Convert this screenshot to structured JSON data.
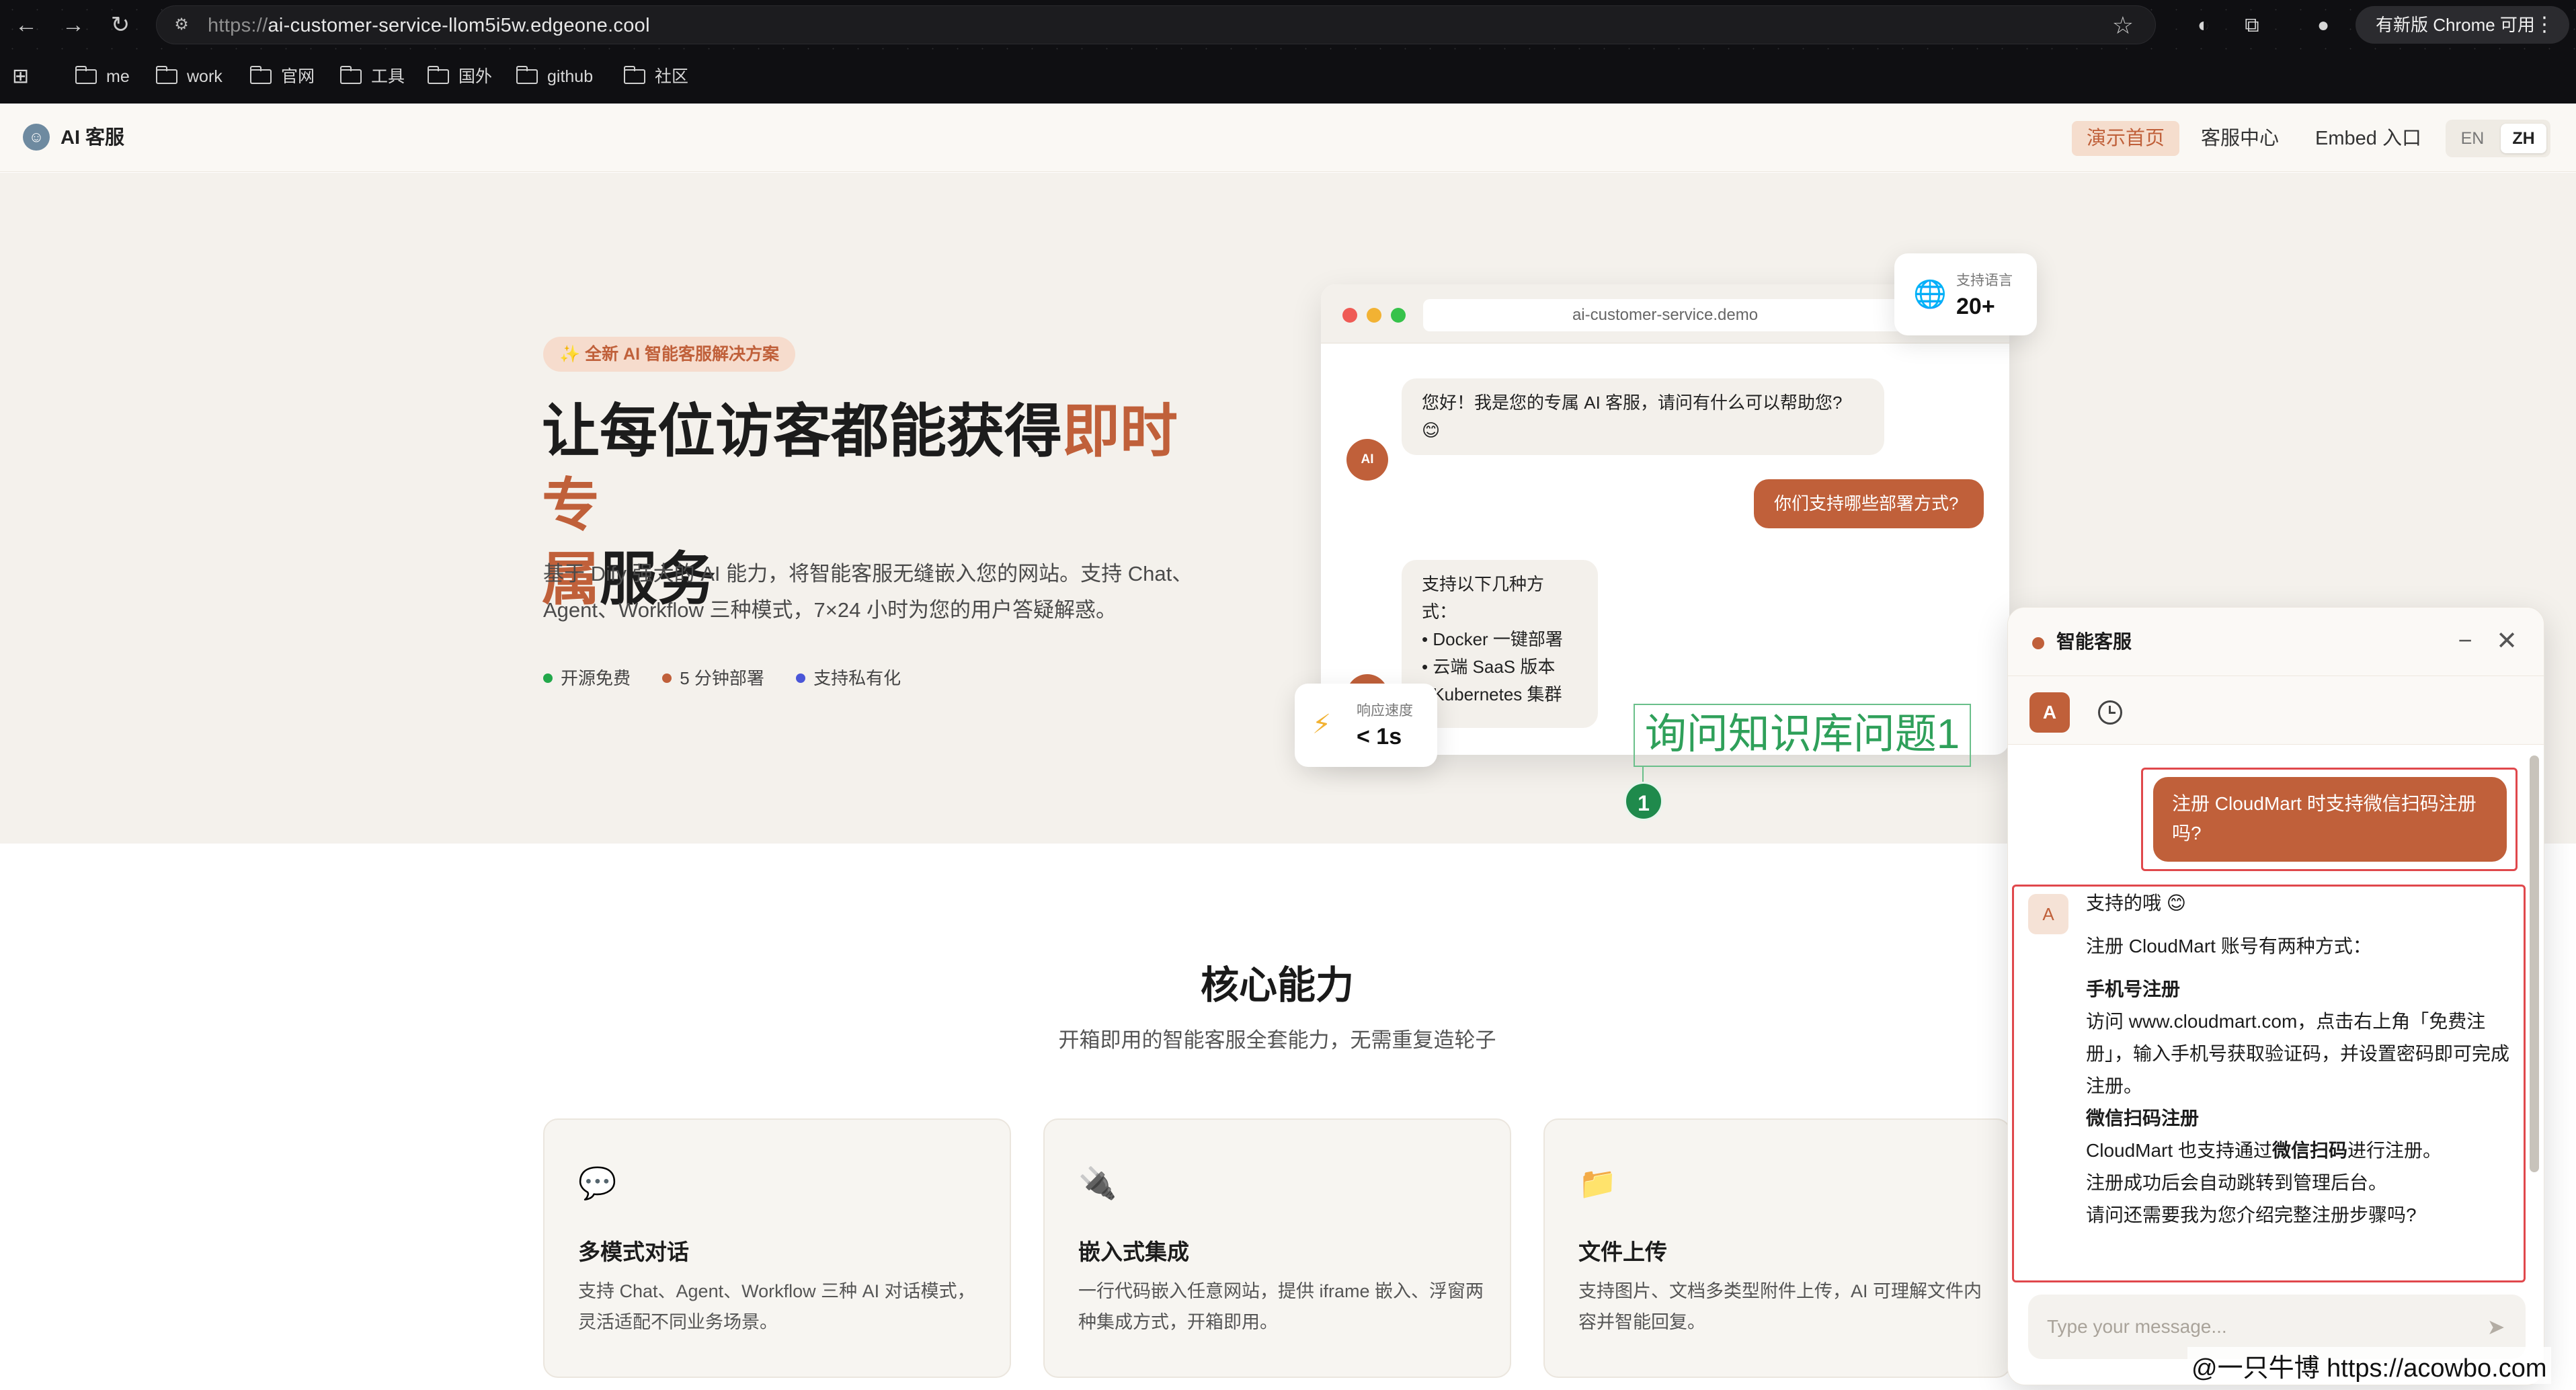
{
  "browser": {
    "url_protocol": "https://",
    "url_host": "ai-customer-service-llom5i5w.edgeone.cool",
    "update_button": "有新版 Chrome 可用",
    "bookmarks": [
      "me",
      "work",
      "官网",
      "工具",
      "国外",
      "github",
      "社区"
    ]
  },
  "header": {
    "logo_text": "AI 客服",
    "nav": [
      "演示首页",
      "客服中心",
      "Embed 入口"
    ],
    "lang": [
      "EN",
      "ZH"
    ]
  },
  "hero": {
    "badge": "✨ 全新 AI 智能客服解决方案",
    "title_line1_a": "让每位访客都能获得",
    "title_line1_b": "即时专",
    "title_line2_a": "属",
    "title_line2_b": "服务",
    "desc_line1": "基于 Dify 强大的 AI 能力，将智能客服无缝嵌入您的网站。支持 Chat、",
    "desc_line2": "Agent、Workflow 三种模式，7×24 小时为您的用户答疑解惑。",
    "points": [
      {
        "label": "开源免费",
        "color": "#22a84a"
      },
      {
        "label": "5 分钟部署",
        "color": "#c0603a"
      },
      {
        "label": "支持私有化",
        "color": "#4a56d8"
      }
    ]
  },
  "demo": {
    "url": "ai-customer-service.demo",
    "avatar": "AI",
    "bot_greeting_1": "您好！我是您的专属 AI 客服，请问有什么可以帮助您?",
    "bot_greeting_2": "😊",
    "user_msg": "你们支持哪些部署方式?",
    "bot_reply": [
      "支持以下几种方式：",
      "• Docker 一键部署",
      "• 云端 SaaS 版本",
      "• Kubernetes 集群"
    ],
    "lang_card": {
      "label": "支持语言",
      "value": "20+"
    },
    "speed_card": {
      "label": "响应速度",
      "value": "< 1s"
    }
  },
  "annotation": {
    "text": "询问知识库问题1",
    "pin": "1"
  },
  "features": {
    "title": "核心能力",
    "subtitle": "开箱即用的智能客服全套能力，无需重复造轮子",
    "cards": [
      {
        "icon": "💬",
        "title": "多模式对话",
        "desc": "支持 Chat、Agent、Workflow 三种 AI 对话模式，灵活适配不同业务场景。"
      },
      {
        "icon": "🔌",
        "title": "嵌入式集成",
        "desc": "一行代码嵌入任意网站，提供 iframe 嵌入、浮窗两种集成方式，开箱即用。"
      },
      {
        "icon": "📁",
        "title": "文件上传",
        "desc": "支持图片、文档多类型附件上传，AI 可理解文件内容并智能回复。"
      }
    ]
  },
  "widget": {
    "title": "智能客服",
    "avatar_letter": "A",
    "user_msg": "注册 CloudMart 时支持微信扫码注册吗?",
    "bot": {
      "greeting": "支持的哦 😊",
      "intro": "注册 CloudMart 账号有两种方式：",
      "phone_title": "手机号注册",
      "phone_text": "访问 www.cloudmart.com，点击右上角「免费注册」，输入手机号获取验证码，并设置密码即可完成注册。",
      "wechat_title": "微信扫码注册",
      "wechat_text_a": "CloudMart 也支持通过",
      "wechat_text_b": "微信扫码",
      "wechat_text_c": "进行注册。",
      "after": "注册成功后会自动跳转到管理后台。",
      "question": "请问还需要我为您介绍完整注册步骤吗?"
    },
    "input_placeholder": "Type your message..."
  },
  "watermark": "@一只牛博 https://acowbo.com"
}
